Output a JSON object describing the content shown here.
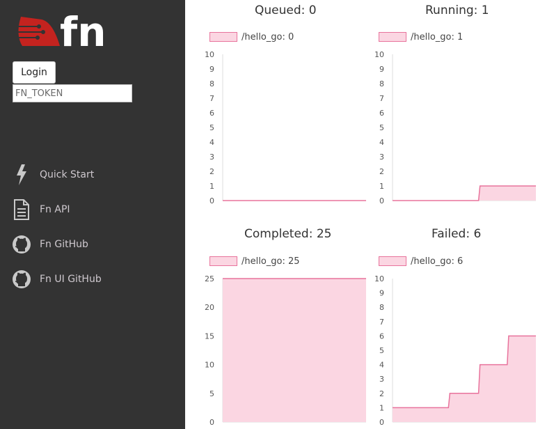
{
  "sidebar": {
    "logo_text": "fn",
    "login_label": "Login",
    "token_placeholder": "FN_TOKEN",
    "token_value": "",
    "nav": [
      {
        "label": "Quick Start",
        "icon": "lightning-icon"
      },
      {
        "label": "Fn API",
        "icon": "document-icon"
      },
      {
        "label": "Fn GitHub",
        "icon": "github-icon"
      },
      {
        "label": "Fn UI GitHub",
        "icon": "github-icon"
      }
    ]
  },
  "colors": {
    "sidebar_bg": "#333333",
    "brand_red": "#c4231f",
    "series_line": "#e8739c",
    "series_fill": "#fbd6e2"
  },
  "charts": [
    {
      "title": "Queued: 0",
      "legend": "/hello_go: 0"
    },
    {
      "title": "Running: 1",
      "legend": "/hello_go: 1"
    },
    {
      "title": "Completed: 25",
      "legend": "/hello_go: 25"
    },
    {
      "title": "Failed: 6",
      "legend": "/hello_go: 6"
    }
  ],
  "chart_data": [
    {
      "type": "area",
      "title": "Queued: 0",
      "ylim": [
        0,
        10
      ],
      "yticks": [
        0,
        1,
        2,
        3,
        4,
        5,
        6,
        7,
        8,
        9,
        10
      ],
      "series": [
        {
          "name": "/hello_go: 0",
          "x": [
            0,
            1
          ],
          "values": [
            0,
            0
          ]
        }
      ]
    },
    {
      "type": "area",
      "title": "Running: 1",
      "ylim": [
        0,
        10
      ],
      "yticks": [
        0,
        1,
        2,
        3,
        4,
        5,
        6,
        7,
        8,
        9,
        10
      ],
      "series": [
        {
          "name": "/hello_go: 1",
          "x": [
            0,
            0.6,
            0.61,
            1
          ],
          "values": [
            0,
            0,
            1,
            1
          ]
        }
      ]
    },
    {
      "type": "area",
      "title": "Completed: 25",
      "ylim": [
        0,
        25
      ],
      "yticks": [
        0,
        5,
        10,
        15,
        20,
        25
      ],
      "series": [
        {
          "name": "/hello_go: 25",
          "x": [
            0,
            1
          ],
          "values": [
            25,
            25
          ]
        }
      ]
    },
    {
      "type": "area",
      "title": "Failed: 6",
      "ylim": [
        0,
        10
      ],
      "yticks": [
        0,
        1,
        2,
        3,
        4,
        5,
        6,
        7,
        8,
        9,
        10
      ],
      "series": [
        {
          "name": "/hello_go: 6",
          "x": [
            0,
            0.39,
            0.4,
            0.6,
            0.61,
            0.8,
            0.81,
            1
          ],
          "values": [
            1,
            1,
            2,
            2,
            4,
            4,
            6,
            6
          ]
        }
      ]
    }
  ]
}
